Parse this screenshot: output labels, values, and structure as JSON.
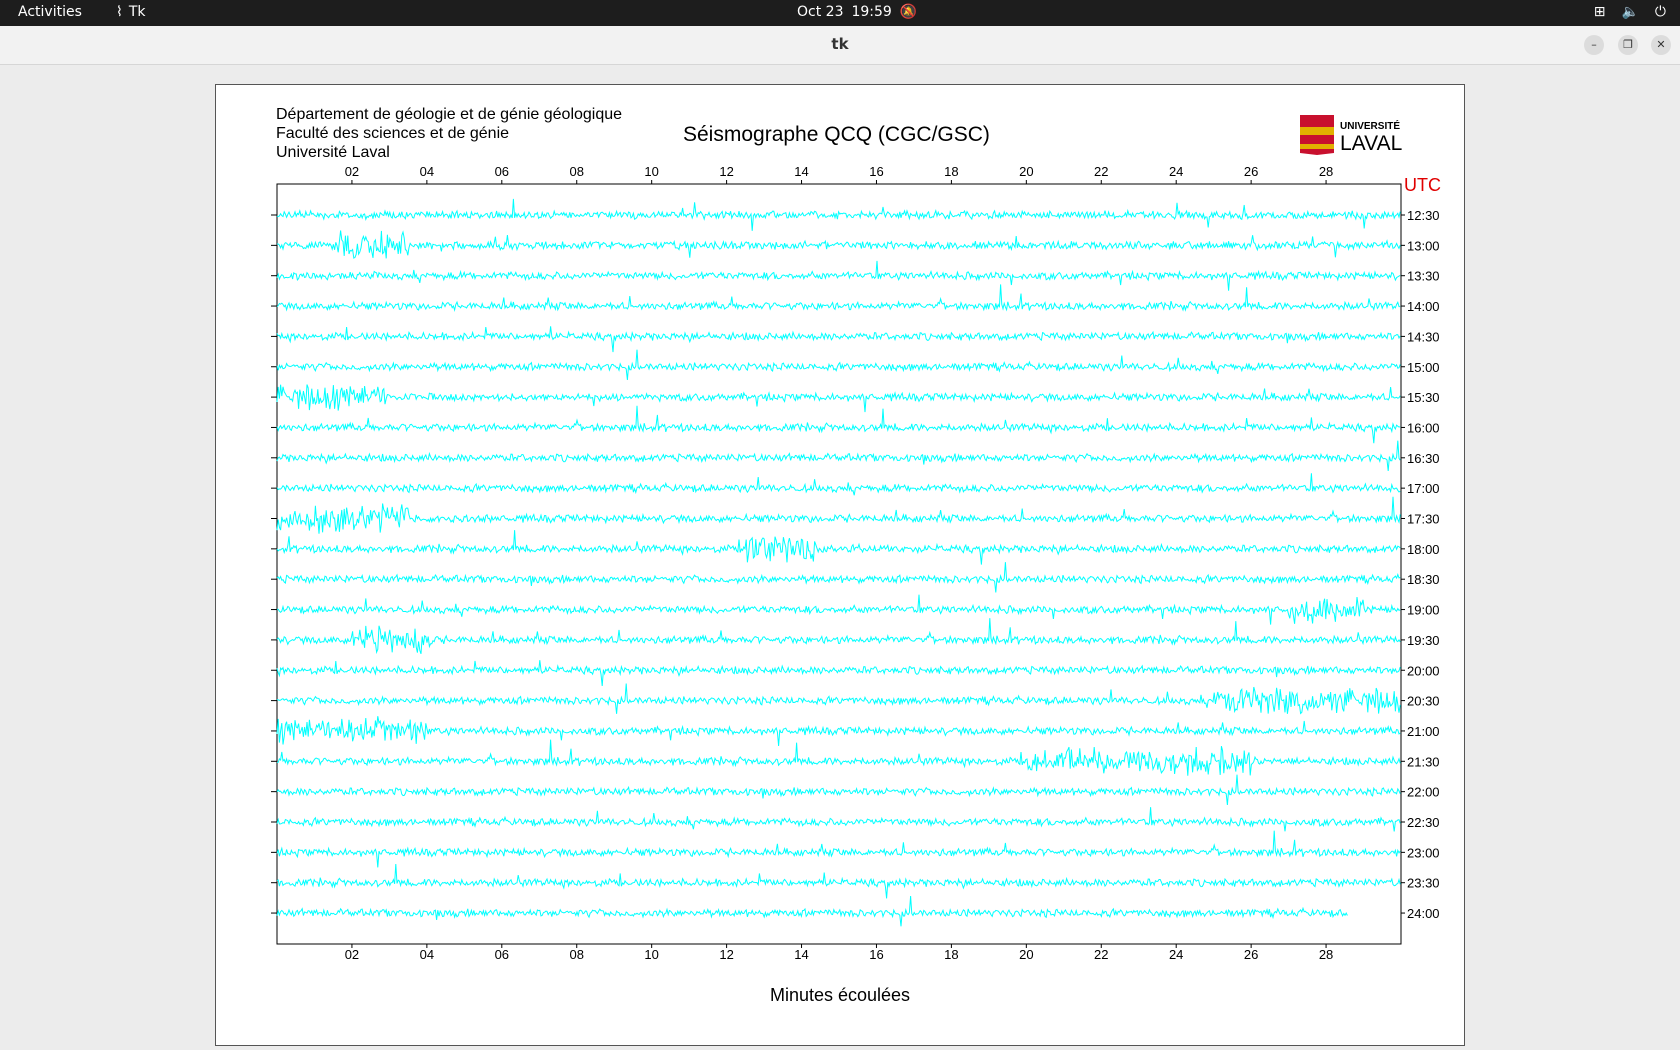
{
  "topbar": {
    "activities": "Activities",
    "app_name": "Tk",
    "date": "Oct 23",
    "time": "19:59"
  },
  "window": {
    "title": "tk"
  },
  "header": {
    "dept": "Département de géologie et de génie géologique",
    "faculty": "Faculté des sciences et de génie",
    "university": "Université Laval"
  },
  "logo": {
    "line1": "UNIVERSITÉ",
    "line2": "LAVAL"
  },
  "chart_title": "Séismographe QCQ (CGC/GSC)",
  "utc_label": "UTC",
  "colors": {
    "trace": "#00ffff",
    "utc": "#e00000",
    "frame": "#000000"
  },
  "chart_data": {
    "type": "line",
    "title": "Séismographe QCQ (CGC/GSC)",
    "xlabel": "Minutes écoulées",
    "ylabel": "UTC",
    "xlim": [
      0,
      30
    ],
    "x_ticks": [
      "02",
      "04",
      "06",
      "08",
      "10",
      "12",
      "14",
      "16",
      "18",
      "20",
      "22",
      "24",
      "26",
      "28"
    ],
    "x_tick_values": [
      2,
      4,
      6,
      8,
      10,
      12,
      14,
      16,
      18,
      20,
      22,
      24,
      26,
      28
    ],
    "rows": [
      "12:30",
      "13:00",
      "13:30",
      "14:00",
      "14:30",
      "15:00",
      "15:30",
      "16:00",
      "16:30",
      "17:00",
      "17:30",
      "18:00",
      "18:30",
      "19:00",
      "19:30",
      "20:00",
      "20:30",
      "21:00",
      "21:30",
      "22:00",
      "22:30",
      "23:00",
      "23:30",
      "24:00"
    ],
    "last_row_end_minute": 28.6,
    "series_color": "#00ffff",
    "note_events": [
      {
        "row": "13:00",
        "from": 1.5,
        "to": 3.5
      },
      {
        "row": "15:30",
        "from": 0,
        "to": 3
      },
      {
        "row": "17:30",
        "from": 0,
        "to": 3.5
      },
      {
        "row": "18:00",
        "from": 12.5,
        "to": 14.5
      },
      {
        "row": "19:00",
        "from": 27,
        "to": 29
      },
      {
        "row": "19:30",
        "from": 2,
        "to": 4.2
      },
      {
        "row": "20:30",
        "from": 25,
        "to": 30
      },
      {
        "row": "21:00",
        "from": 0,
        "to": 4
      },
      {
        "row": "21:30",
        "from": 20,
        "to": 26
      }
    ],
    "grid": false
  }
}
